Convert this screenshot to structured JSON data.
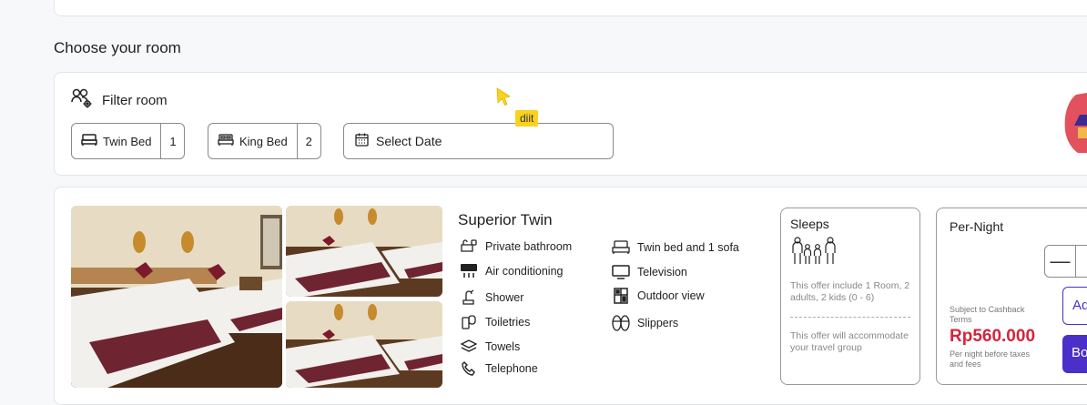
{
  "section_title": "Choose your room",
  "filter": {
    "title": "Filter room",
    "beds": [
      {
        "label": "Twin Bed",
        "count": "1",
        "icon": "bed-icon"
      },
      {
        "label": "King Bed",
        "count": "2",
        "icon": "bed-icon"
      }
    ],
    "date_label": "Select Date",
    "tooltip": "diit"
  },
  "room": {
    "title": "Superior Twin",
    "amenities_left": [
      {
        "label": "Private bathroom",
        "icon": "bathroom-icon"
      },
      {
        "label": "Air conditioning",
        "icon": "ac-icon"
      },
      {
        "label": "Shower",
        "icon": "shower-icon"
      },
      {
        "label": "Toiletries",
        "icon": "toiletries-icon"
      },
      {
        "label": "Towels",
        "icon": "towels-icon"
      },
      {
        "label": "Telephone",
        "icon": "telephone-icon"
      }
    ],
    "amenities_right": [
      {
        "label": "Twin bed and 1 sofa",
        "icon": "sofa-icon"
      },
      {
        "label": "Television",
        "icon": "tv-icon"
      },
      {
        "label": "Outdoor view",
        "icon": "window-icon"
      },
      {
        "label": "Slippers",
        "icon": "slippers-icon"
      }
    ],
    "sleeps": {
      "title": "Sleeps",
      "include_text": "This offer include 1 Room, 2 adults, 2 kids (0 - 6)",
      "accommodate_text": "This offer will accommodate your travel group"
    },
    "pricing": {
      "title": "Per-Night",
      "cashback": "Subject to Cashback Terms",
      "price": "Rp560.000",
      "price_note": "Per night before taxes and fees",
      "add_label": "Add",
      "book_label": "Book",
      "accent": "#4b2fc9",
      "price_color": "#d5243c"
    }
  }
}
